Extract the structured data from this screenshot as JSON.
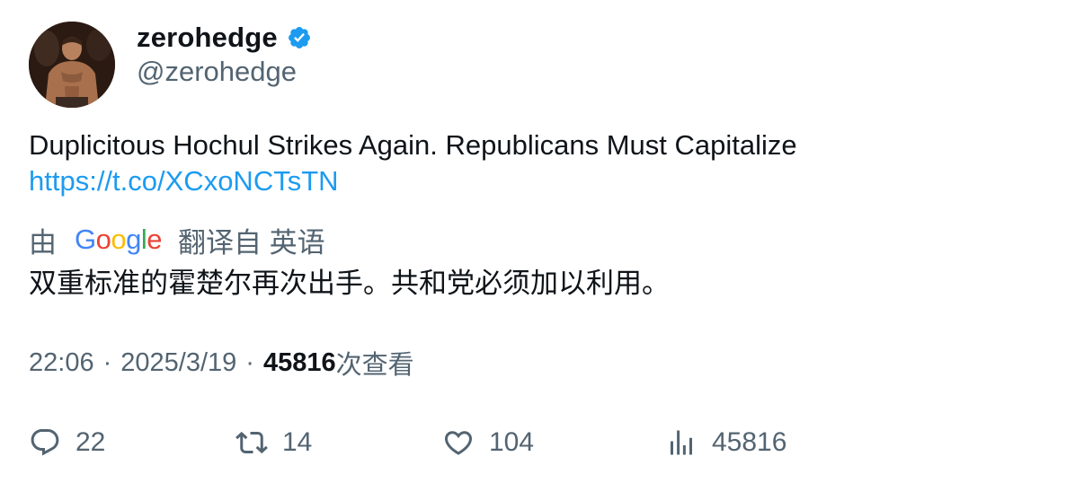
{
  "author": {
    "display_name": "zerohedge",
    "handle": "@zerohedge",
    "verified": true,
    "verified_color": "#1d9bf0"
  },
  "tweet": {
    "text": "Duplicitous Hochul Strikes Again. Republicans Must Capitalize",
    "link": "https://t.co/XCxoNCTsTN",
    "link_color": "#1d9bf0"
  },
  "translation": {
    "prefix": "由",
    "provider": "Google",
    "suffix": "翻译自 英语",
    "text": "双重标准的霍楚尔再次出手。共和党必须加以利用。"
  },
  "meta": {
    "time": "22:06",
    "date": "2025/3/19",
    "views_count": "45816",
    "views_label": "次查看"
  },
  "actions": {
    "replies": "22",
    "retweets": "14",
    "likes": "104",
    "views": "45816"
  },
  "icons": {
    "reply": "reply-icon",
    "retweet": "retweet-icon",
    "like": "heart-icon",
    "views": "analytics-icon",
    "verified": "verified-badge-icon"
  }
}
